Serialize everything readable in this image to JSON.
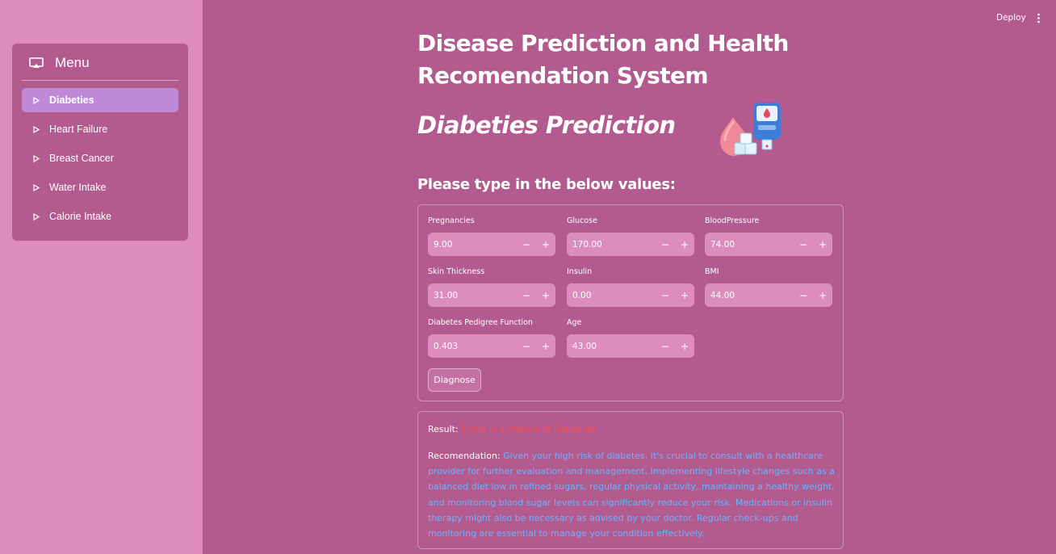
{
  "sidebar": {
    "title": "Menu",
    "items": [
      {
        "label": "Diabeties"
      },
      {
        "label": "Heart Failure"
      },
      {
        "label": "Breast Cancer"
      },
      {
        "label": "Water Intake"
      },
      {
        "label": "Calorie Intake"
      }
    ]
  },
  "toolbar": {
    "deploy_label": "Deploy"
  },
  "main": {
    "title": "Disease Prediction and Health Recomendation System",
    "subtitle": "Diabeties Prediction",
    "prompt": "Please type in the below values:",
    "fields": [
      {
        "label": "Pregnancies",
        "value": "9.00"
      },
      {
        "label": "Glucose",
        "value": "170.00"
      },
      {
        "label": "BloodPressure",
        "value": "74.00"
      },
      {
        "label": "Skin Thickness",
        "value": "31.00"
      },
      {
        "label": "Insulin",
        "value": "0.00"
      },
      {
        "label": "BMI",
        "value": "44.00"
      },
      {
        "label": "Diabetes Pedigree Function",
        "value": "0.403"
      },
      {
        "label": "Age",
        "value": "43.00"
      }
    ],
    "minus": "−",
    "plus": "+",
    "diagnose_label": "Diagnose",
    "result_label": "Result:",
    "result_value": "There is a chance of Diabeties",
    "rec_label": "Recomendation:",
    "rec_text": "Given your high risk of diabetes, it's crucial to consult with a healthcare provider for further evaluation and management. Implementing lifestyle changes such as a balanced diet low in refined sugars, regular physical activity, maintaining a healthy weight, and monitoring blood sugar levels can significantly reduce your risk. Medications or insulin therapy might also be necessary as advised by your doctor. Regular check-ups and monitoring are essential to manage your condition effectively."
  },
  "colors": {
    "background": "#b35b8f",
    "sidebar": "#dc8cbd",
    "active_item": "#be8ad8",
    "error_text": "#ff4b4b",
    "info_text": "#6ab3ff"
  },
  "icons": {
    "menu": "cast-icon",
    "item": "caret-right-icon",
    "more": "kebab-menu-icon",
    "illustration": "glucometer-icon"
  }
}
